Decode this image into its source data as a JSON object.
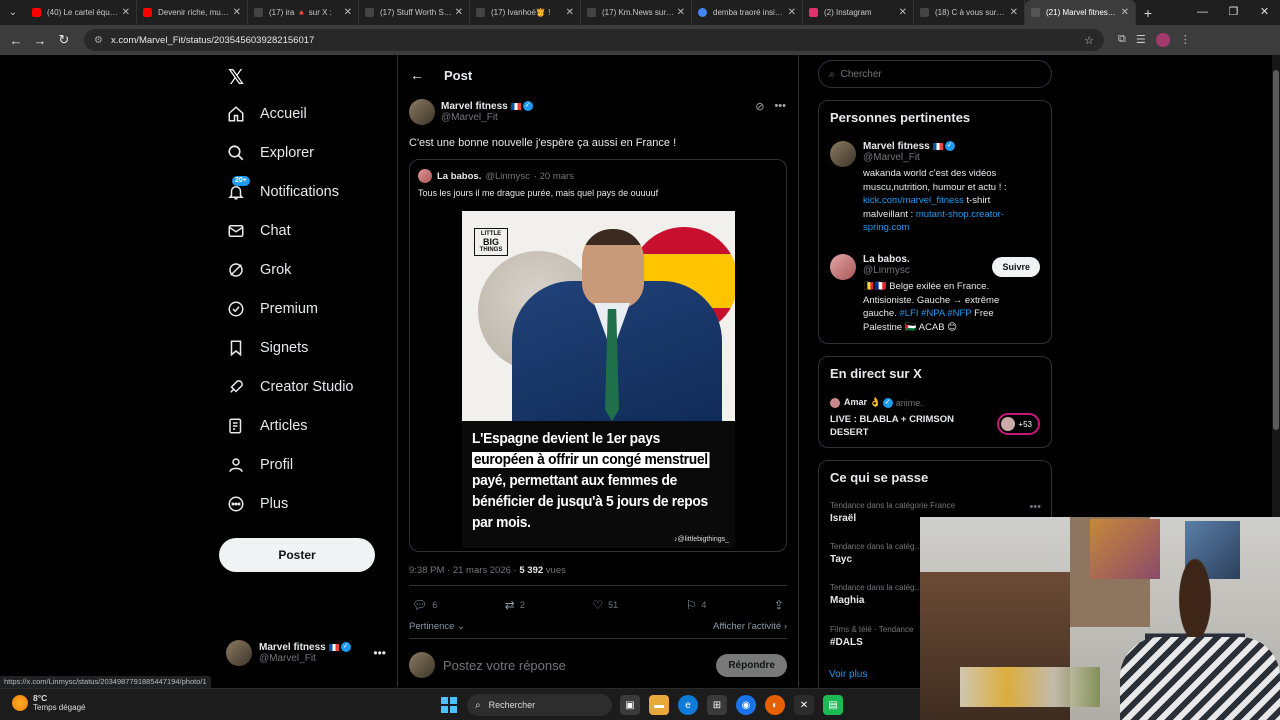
{
  "browser": {
    "tabs": [
      {
        "title": "(40) Le cartel équ…",
        "color": "#ff0000"
      },
      {
        "title": "Devenir riche, mu…",
        "color": "#ff0000"
      },
      {
        "title": "(17) ira 🔺 sur X :",
        "color": "#333333"
      },
      {
        "title": "(17) Stuff Worth S…",
        "color": "#333333"
      },
      {
        "title": "(17) Ivanhoé🫅 !",
        "color": "#333333"
      },
      {
        "title": "(17) Km.News sur…",
        "color": "#333333"
      },
      {
        "title": "demba traoré insi…",
        "color": "#4285f4"
      },
      {
        "title": "(2) Instagram",
        "color": "#e1306c"
      },
      {
        "title": "(18) C à vous sur…",
        "color": "#333333"
      },
      {
        "title": "(21) Marvel fitnes…",
        "color": "#333333"
      }
    ],
    "url": "x.com/Marvel_Fit/status/2035456039282156017",
    "status_url": "https://x.com/Linmysc/status/2034987791885447194/photo/1"
  },
  "nav": {
    "items": [
      {
        "label": "Accueil",
        "icon": "home-icon"
      },
      {
        "label": "Explorer",
        "icon": "search-icon"
      },
      {
        "label": "Notifications",
        "icon": "bell-icon",
        "badge": "20+"
      },
      {
        "label": "Chat",
        "icon": "mail-icon"
      },
      {
        "label": "Grok",
        "icon": "grok-icon"
      },
      {
        "label": "Premium",
        "icon": "premium-icon"
      },
      {
        "label": "Signets",
        "icon": "bookmark-icon"
      },
      {
        "label": "Creator Studio",
        "icon": "rocket-icon"
      },
      {
        "label": "Articles",
        "icon": "article-icon"
      },
      {
        "label": "Profil",
        "icon": "person-icon"
      },
      {
        "label": "Plus",
        "icon": "more-icon"
      }
    ],
    "post_button": "Poster",
    "me": {
      "name": "Marvel fitness",
      "handle": "@Marvel_Fit"
    }
  },
  "post": {
    "header": "Post",
    "author_name": "Marvel fitness",
    "author_handle": "@Marvel_Fit",
    "text": "C'est une bonne nouvelle j'espère ça aussi en France !",
    "quote": {
      "name": "La babos.",
      "handle": "@Linmysc",
      "date": "· 20 mars",
      "text": "Tous les jours il me drague purée, mais quel pays de ouuuuf",
      "image": {
        "brand_top": "LITTLE",
        "brand_mid": "BIG",
        "brand_bottom": "THINGS",
        "line1": "L'Espagne devient le 1er pays",
        "line2": "européen à offrir un congé menstruel",
        "line3": "payé, permettant aux femmes de",
        "line4": "bénéficier de jusqu'à 5 jours de repos",
        "line5": "par mois.",
        "credit": "♪@littlebigthings_"
      }
    },
    "time": "9:38 PM · 21 mars 2026 · ",
    "views": "5 392",
    "views_label": " vues",
    "replies": "6",
    "reposts": "2",
    "likes": "51",
    "bookmarks": "4",
    "sort_label": "Pertinence ⌄",
    "activity_label": "Afficher l'activité ›",
    "reply_placeholder": "Postez votre réponse",
    "reply_button": "Répondre"
  },
  "sidebar": {
    "search_placeholder": "Chercher",
    "relevant_title": "Personnes pertinentes",
    "person1": {
      "name": "Marvel fitness",
      "handle": "@Marvel_Fit",
      "bio1": "wakanda world c'est des vidéos muscu,nutrition, humour et actu ! : ",
      "link1": "kick.com/marvel_fitness",
      "bio2": " t-shirt malveillant : ",
      "link2": "mutant-shop.creator-spring.com"
    },
    "person2": {
      "name": "La babos.",
      "handle": "@Linmysc",
      "bio1": "🇧🇪🇫🇷 Belge exilée en France. Antisioniste. Gauche → extrême gauche. ",
      "tags": "#LFI #NPA #NFP",
      "bio2": " Free Palestine 🇵🇸 ACAB 😊",
      "follow": "Suivre"
    },
    "live_title": "En direct sur X",
    "live": {
      "host": "Amar 👌",
      "role": "anime.",
      "title": "LIVE : BLABLA + CRIMSON DESERT",
      "count": "+53"
    },
    "trends_title": "Ce qui se passe",
    "trends": [
      {
        "context": "Tendance dans la catégorie France",
        "name": "Israël"
      },
      {
        "context": "Tendance dans la catég…",
        "name": "Tayc"
      },
      {
        "context": "Tendance dans la catég…",
        "name": "Maghia"
      },
      {
        "context": "Films & télé · Tendance",
        "name": "#DALS"
      }
    ],
    "see_more": "Voir plus"
  },
  "taskbar": {
    "temp": "8°C",
    "weather": "Temps dégagé",
    "search": "Rechercher"
  }
}
